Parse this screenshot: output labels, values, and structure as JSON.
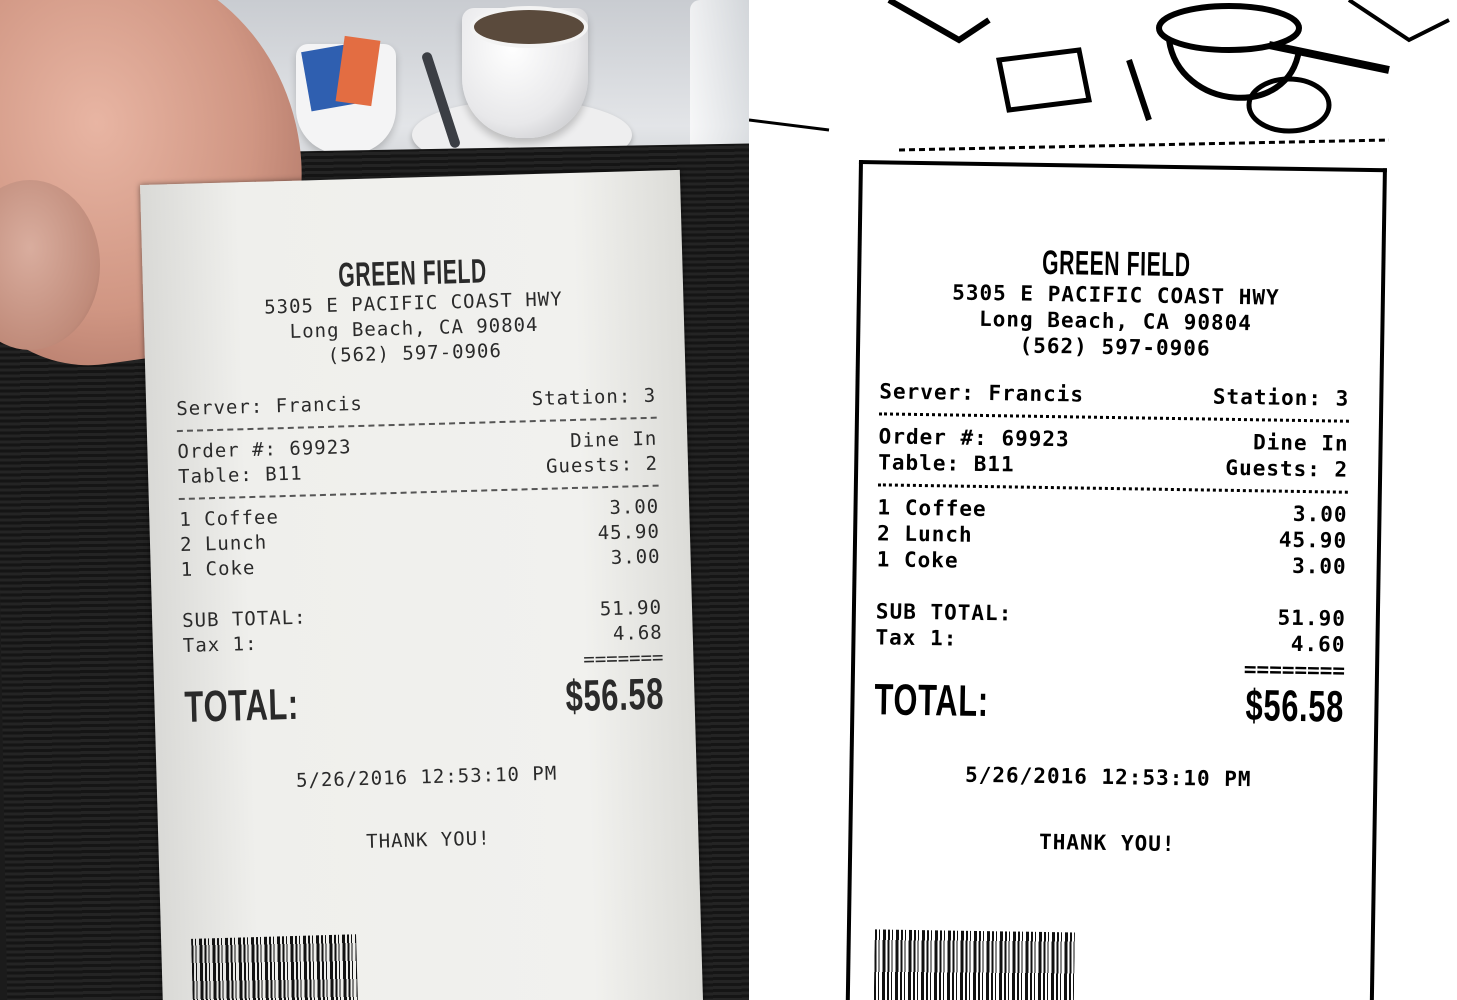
{
  "receipt": {
    "restaurant": "GREEN FIELD",
    "address_line1": "5305 E PACIFIC COAST HWY",
    "address_line2": "Long Beach, CA 90804",
    "phone": "(562) 597-0906",
    "server_label": "Server: Francis",
    "station_label": "Station: 3",
    "order_label": "Order #: 69923",
    "service_type": "Dine In",
    "table_label": "Table: B11",
    "guests_label": "Guests: 2",
    "items": [
      {
        "qty_name": "1 Coffee",
        "price": "3.00"
      },
      {
        "qty_name": "2 Lunch",
        "price": "45.90"
      },
      {
        "qty_name": "1 Coke",
        "price": "3.00"
      }
    ],
    "subtotal_label": "SUB TOTAL:",
    "subtotal_value": "51.90",
    "tax_label": "Tax 1:",
    "tax_value": "4.68",
    "separator": "=======",
    "total_label": "TOTAL:",
    "total_value": "$56.58",
    "datetime": "5/26/2016 12:53:10 PM",
    "thank_you": "THANK YOU!"
  },
  "scan": {
    "restaurant": "GREEN FIELD",
    "address_line1": "5305 E PACIFIC COAST HWY",
    "address_line2": "Long Beach, CA 90804",
    "phone": "(562) 597-0906",
    "server_label": "Server: Francis",
    "station_label": "Station: 3",
    "order_label": "Order #: 69923",
    "service_type": "Dine In",
    "table_label": "Table: B11",
    "guests_label": "Guests: 2",
    "items": [
      {
        "qty_name": "1 Coffee",
        "price": "3.00"
      },
      {
        "qty_name": "2 Lunch",
        "price": "45.90"
      },
      {
        "qty_name": "1 Coke",
        "price": "3.00"
      }
    ],
    "subtotal_label": "SUB TOTAL:",
    "subtotal_value": "51.90",
    "tax_label": "Tax 1:",
    "tax_value": "4.60",
    "separator": "========",
    "total_label": "TOTAL:",
    "total_value": "$56.58",
    "datetime": "5/26/2016 12:53:10 PM",
    "thank_you": "THANK YOU!"
  }
}
